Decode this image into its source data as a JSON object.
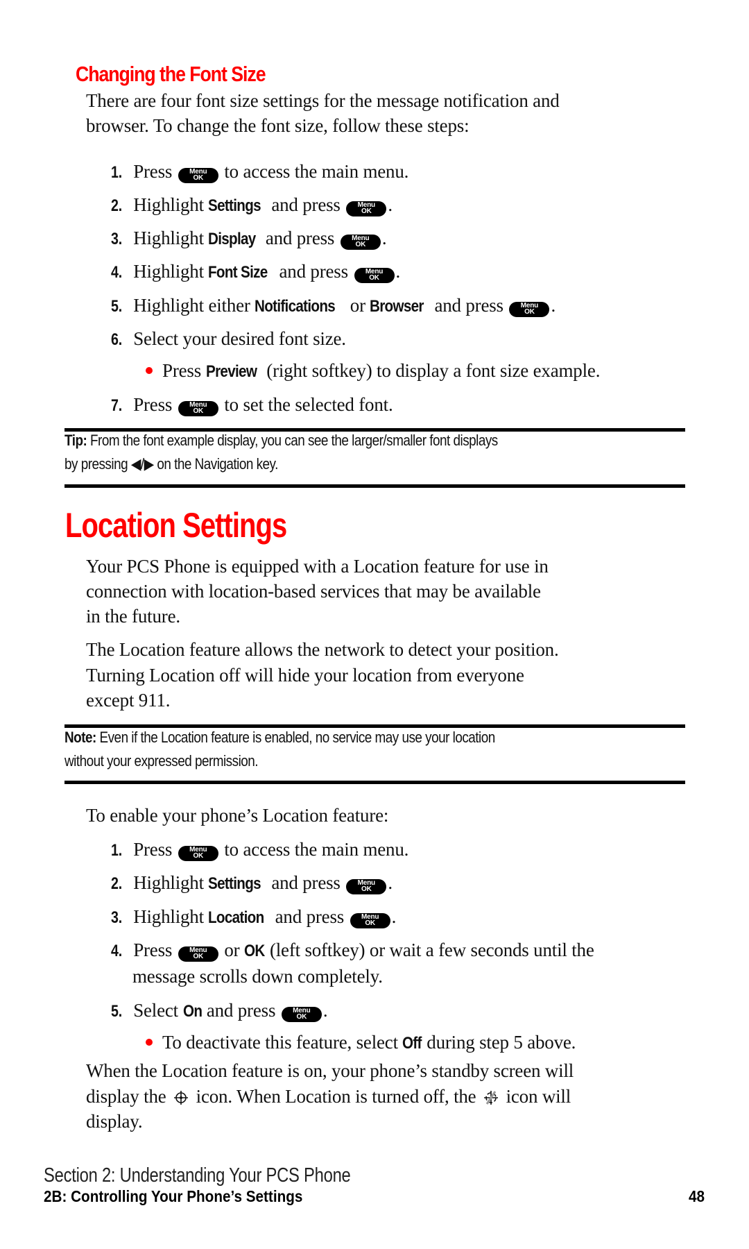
{
  "font_section": {
    "heading": "Changing the Font Size",
    "intro": [
      "There are four font size settings for the message notification and",
      "browser. To change the font size, follow these steps:"
    ],
    "steps": [
      {
        "num": "1.",
        "pre": "Press",
        "bold": "",
        "mid": "",
        "key": true,
        "post": "to access the main menu."
      },
      {
        "num": "2.",
        "pre": "Highlight",
        "bold": "Settings",
        "mid": "and press",
        "key": true,
        "post": "."
      },
      {
        "num": "3.",
        "pre": "Highlight",
        "bold": "Display",
        "mid": "and press",
        "key": true,
        "post": "."
      },
      {
        "num": "4.",
        "pre": "Highlight",
        "bold": "Font Size",
        "mid": "and press",
        "key": true,
        "post": "."
      },
      {
        "num": "5.",
        "pre": "Highlight either",
        "bold": "Notifications",
        "mid2": "or",
        "bold2": "Browser",
        "mid": "and press",
        "key": true,
        "post": "."
      },
      {
        "num": "6.",
        "pre": "Select your desired font size."
      },
      {
        "num": "7.",
        "pre": "Press",
        "key": true,
        "post": "to set the selected font."
      }
    ],
    "bullet": {
      "pre": "Press",
      "bold": "Preview",
      "post": "(right softkey) to display a font size example."
    }
  },
  "menu_key": {
    "top": "Menu",
    "bottom": "OK"
  },
  "tip": {
    "label": "Tip:",
    "line1": "From the font example display, you can see the larger/smaller font displays",
    "line2_pre": "by pressing",
    "arrows": "◀/▶",
    "line2_post": "on the Navigation key."
  },
  "location_section": {
    "heading": "Location Settings",
    "para1": [
      "Your PCS Phone is equipped with a Location feature for use in",
      "connection with location-based services that may be available",
      "in the future."
    ],
    "para2": [
      "The Location feature allows the network to detect your position.",
      "Turning Location off will hide your location from everyone",
      "except 911."
    ],
    "note": {
      "label": "Note:",
      "line1": "Even if the Location feature is enabled, no service may use your location",
      "line2": "without your expressed permission."
    },
    "enable_intro": "To enable your phone’s Location feature:",
    "steps": [
      {
        "num": "1.",
        "pre": "Press",
        "post": "to access the main menu."
      },
      {
        "num": "2.",
        "pre": "Highlight",
        "bold": "Settings",
        "mid": "and press",
        "post": "."
      },
      {
        "num": "3.",
        "pre": "Highlight",
        "bold": "Location",
        "mid": "and press",
        "post": "."
      },
      {
        "num": "4.",
        "pre": "Press",
        "mid": "or",
        "bold": "OK",
        "post": "(left softkey) or wait a few seconds until the",
        "cont": "message scrolls down completely."
      },
      {
        "num": "5.",
        "pre": "Select",
        "bold": "On",
        "mid": "and press",
        "post": "."
      }
    ],
    "bullet": {
      "pre": "To deactivate this feature, select",
      "bold": "Off",
      "post": "during step 5 above."
    },
    "closing": {
      "l1": "When the Location feature is on, your phone’s standby screen will",
      "l2a": "display the",
      "l2b": "icon. When Location is turned off, the",
      "l2c": "icon will",
      "l3": "display."
    }
  },
  "footer": {
    "section": "Section 2: Understanding Your PCS Phone",
    "chapter": "2B: Controlling Your Phone’s Settings",
    "page": "48"
  },
  "colors": {
    "accent": "#ff0000",
    "text": "#111111"
  }
}
